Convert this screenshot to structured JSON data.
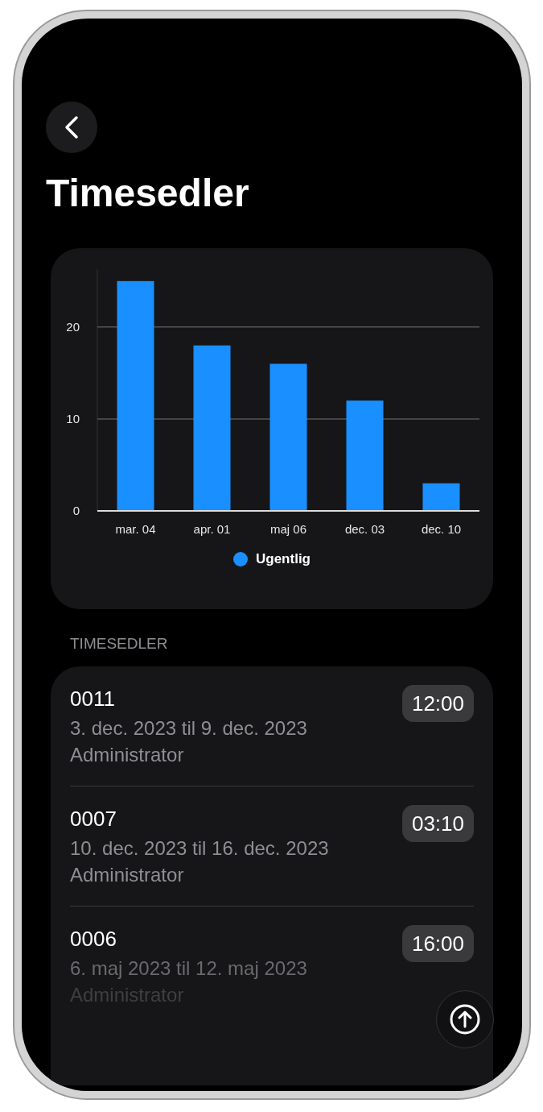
{
  "header": {
    "title": "Timesedler"
  },
  "chart": {
    "chart_data": {
      "type": "bar",
      "categories": [
        "mar. 04",
        "apr. 01",
        "maj 06",
        "dec. 03",
        "dec. 10"
      ],
      "series": [
        {
          "name": "Ugentlig",
          "color": "#1a8fff",
          "values": [
            25,
            18,
            16,
            12,
            3
          ]
        }
      ],
      "ylim": [
        0,
        26.3
      ],
      "yticks": [
        0,
        10,
        20
      ]
    }
  },
  "section": {
    "title": "TIMESEDLER"
  },
  "timesheets": [
    {
      "number": "0011",
      "period": "3. dec. 2023 til 9. dec. 2023",
      "owner": "Administrator",
      "hours": "12:00"
    },
    {
      "number": "0007",
      "period": "10. dec. 2023 til 16. dec. 2023",
      "owner": "Administrator",
      "hours": "03:10"
    },
    {
      "number": "0006",
      "period": "6. maj 2023 til 12. maj 2023",
      "owner": "Administrator",
      "hours": "16:00"
    }
  ]
}
